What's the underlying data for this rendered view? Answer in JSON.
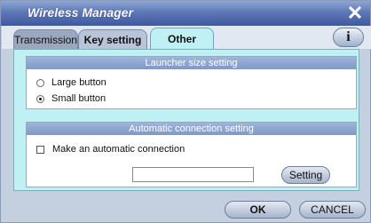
{
  "window": {
    "title": "Wireless Manager",
    "close_label": "✕",
    "info_label": "i"
  },
  "tabs": [
    {
      "label": "Transmission",
      "active": false
    },
    {
      "label": "Key setting",
      "active": false
    },
    {
      "label": "Other",
      "active": true
    }
  ],
  "launcher": {
    "header": "Launcher size setting",
    "options": [
      {
        "label": "Large button",
        "checked": false
      },
      {
        "label": "Small button",
        "checked": true
      }
    ]
  },
  "auto_connection": {
    "header": "Automatic connection setting",
    "checkbox_label": "Make an automatic connection",
    "checkbox_checked": false,
    "field_value": "",
    "setting_button": "Setting"
  },
  "footer": {
    "ok_label": "OK",
    "cancel_label": "CANCEL"
  }
}
